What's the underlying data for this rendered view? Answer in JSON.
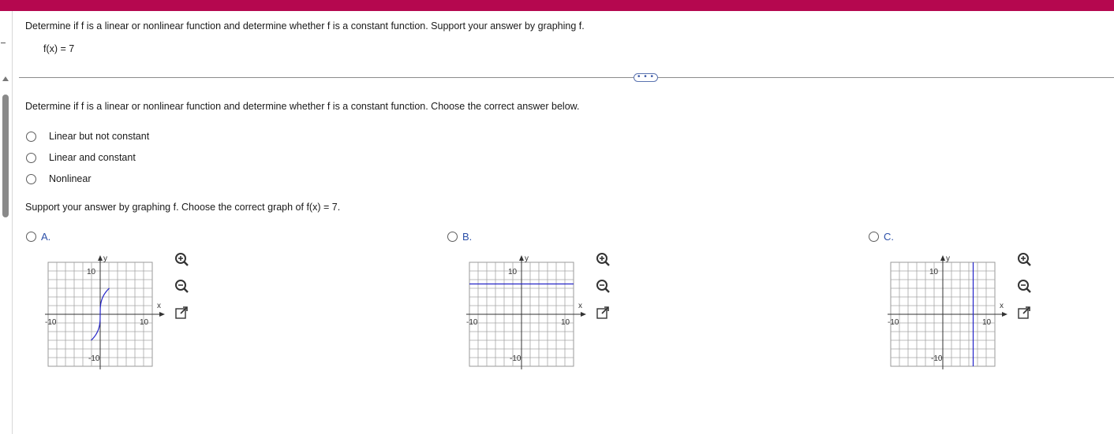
{
  "header": {
    "accent_color": "#b5084f"
  },
  "question": {
    "prompt": "Determine if f is a linear or nonlinear function and determine whether f is a constant function. Support your answer by graphing f.",
    "function": "f(x) = 7"
  },
  "more_button": {
    "label": "• • •"
  },
  "part1": {
    "prompt": "Determine if f is a linear or nonlinear function and determine whether f is a constant function. Choose the correct answer below.",
    "options": [
      "Linear but not constant",
      "Linear and constant",
      "Nonlinear"
    ]
  },
  "part2": {
    "prompt": "Support your answer by graphing f. Choose the correct graph of f(x) = 7.",
    "graphs": [
      {
        "label": "A.",
        "x_axis_label": "x",
        "y_axis_label": "y",
        "tick_min": "-10",
        "tick_max": "10",
        "y_tick_max": "10",
        "y_tick_min": "-10",
        "curve": "cube-root"
      },
      {
        "label": "B.",
        "x_axis_label": "x",
        "y_axis_label": "y",
        "tick_min": "-10",
        "tick_max": "10",
        "y_tick_max": "10",
        "y_tick_min": "-10",
        "curve": "horizontal-line",
        "line_value": 7
      },
      {
        "label": "C.",
        "x_axis_label": "x",
        "y_axis_label": "y",
        "tick_min": "-10",
        "tick_max": "10",
        "y_tick_max": "10",
        "y_tick_min": "-10",
        "curve": "vertical-line",
        "line_value": 7
      }
    ],
    "tool_icons": [
      "zoom-in-icon",
      "zoom-out-icon",
      "open-external-icon"
    ]
  },
  "colors": {
    "curve": "#2424c8",
    "link": "#2b4fa8"
  }
}
